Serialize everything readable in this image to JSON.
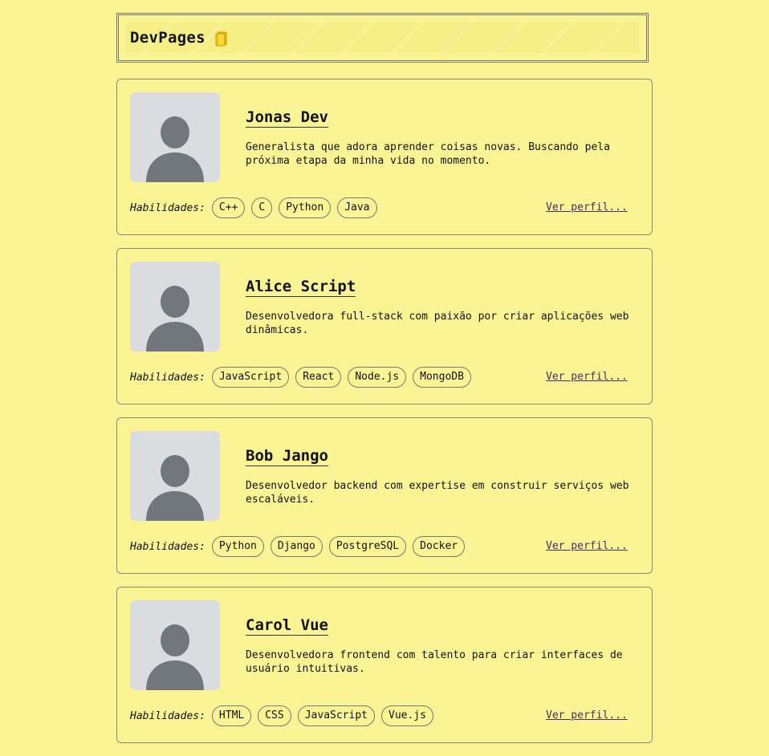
{
  "header": {
    "brand": "DevPages",
    "icon": "notebook-icon"
  },
  "skills_label": "Habilidades:",
  "profile_link_label": "Ver perfil...",
  "developers": [
    {
      "name": "Jonas Dev",
      "description": "Generalista que adora aprender coisas novas. Buscando pela próxima etapa da minha vida no momento.",
      "skills": [
        "C++",
        "C",
        "Python",
        "Java"
      ]
    },
    {
      "name": "Alice Script",
      "description": "Desenvolvedora full-stack com paixão por criar aplicações web dinâmicas.",
      "skills": [
        "JavaScript",
        "React",
        "Node.js",
        "MongoDB"
      ]
    },
    {
      "name": "Bob Jango",
      "description": "Desenvolvedor backend com expertise em construir serviços web escaláveis.",
      "skills": [
        "Python",
        "Django",
        "PostgreSQL",
        "Docker"
      ]
    },
    {
      "name": "Carol Vue",
      "description": "Desenvolvedora frontend com talento para criar interfaces de usuário intuitivas.",
      "skills": [
        "HTML",
        "CSS",
        "JavaScript",
        "Vue.js"
      ]
    }
  ],
  "colors": {
    "page_background": "#fbf495",
    "avatar_background": "#dadce0",
    "avatar_silhouette": "#72767d",
    "link": "#4a2c63"
  }
}
